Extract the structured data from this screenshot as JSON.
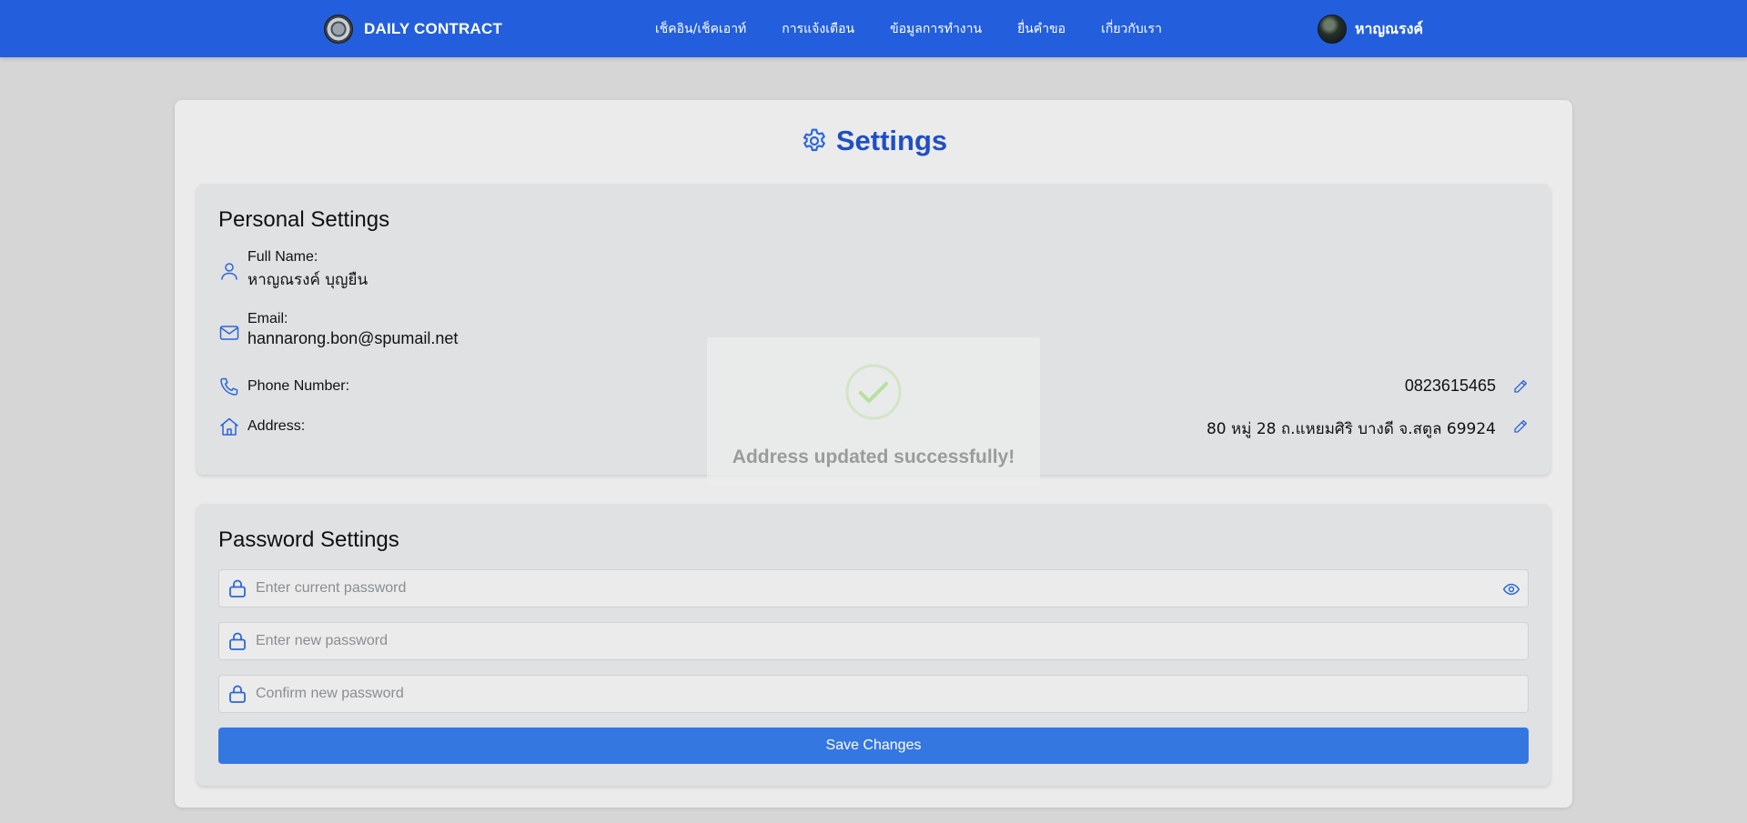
{
  "navbar": {
    "brand": "DAILY CONTRACT",
    "links": [
      "เช็คอิน/เช็คเอาท์",
      "การแจ้งเตือน",
      "ข้อมูลการทำงาน",
      "ยื่นคำขอ",
      "เกี่ยวกับเรา"
    ],
    "user_name": "หาญณรงค์"
  },
  "page": {
    "title": "Settings",
    "accent": "#1f4fc5"
  },
  "personal": {
    "title": "Personal Settings",
    "full_name_label": "Full Name:",
    "full_name_value": "หาญณรงค์ บุญยืน",
    "email_label": "Email:",
    "email_value": "hannarong.bon@spumail.net",
    "phone_label": "Phone Number:",
    "phone_value": "0823615465",
    "address_label": "Address:",
    "address_value": "80 หมู่ 28 ถ.แหยมศิริ บางดี จ.สตูล 69924"
  },
  "password": {
    "title": "Password Settings",
    "current_placeholder": "Enter current password",
    "new_placeholder": "Enter new password",
    "confirm_placeholder": "Confirm new password",
    "save_label": "Save Changes"
  },
  "toast": {
    "message": "Address updated successfully!"
  },
  "colors": {
    "navbar": "#235fdc",
    "button": "#3477e1",
    "icon": "#2b66d9"
  }
}
